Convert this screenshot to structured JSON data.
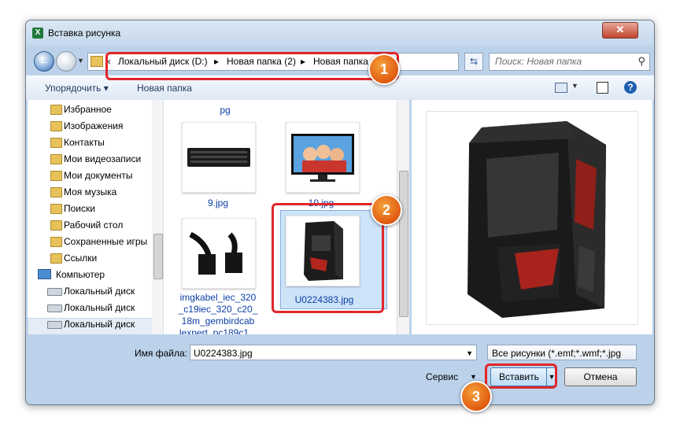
{
  "window": {
    "title": "Вставка рисунка",
    "close_label": "✕"
  },
  "address": {
    "breadcrumbs": [
      "«",
      "Локальный диск (D:)",
      "▸",
      "Новая папка (2)",
      "▸",
      "Новая папка",
      "▸"
    ],
    "search_placeholder": "Поиск: Новая папка"
  },
  "toolbar": {
    "organize_label": "Упорядочить ▾",
    "new_folder_label": "Новая папка",
    "help_label": "?"
  },
  "nav": {
    "items": [
      "Избранное",
      "Изображения",
      "Контакты",
      "Мои видеозаписи",
      "Мои документы",
      "Моя музыка",
      "Поиски",
      "Рабочий стол",
      "Сохраненные игры",
      "Ссылки",
      "Компьютер",
      "Локальный диск",
      "Локальный диск",
      "Локальный диск"
    ]
  },
  "files": {
    "partial_label": "pg",
    "items": [
      {
        "name": "9.jpg"
      },
      {
        "name": "10.jpg"
      },
      {
        "name": "imgkabel_iec_320_c19iec_320_c20_18m_gembirdcablexpert_pc189c1...",
        "lines": [
          "imgkabel_iec_320",
          "_c19iec_320_c20_",
          "18m_gembirdcab",
          "lexpert_pc189c1..."
        ]
      },
      {
        "name": "U0224383.jpg",
        "selected": true
      }
    ]
  },
  "bottom": {
    "filename_label": "Имя файла:",
    "filename_value": "U0224383.jpg",
    "filter_value": "Все рисунки (*.emf;*.wmf;*.jpg",
    "service_label": "Сервис",
    "insert_label": "Вставить",
    "cancel_label": "Отмена"
  },
  "markers": [
    "1",
    "2",
    "3"
  ],
  "colors": {
    "highlight": "#e0262a",
    "marker": "#e05a10",
    "link": "#0b3ea8"
  }
}
